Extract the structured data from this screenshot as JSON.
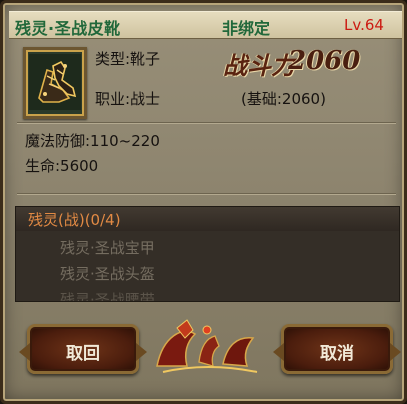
{
  "item": {
    "name": "残灵·圣战皮靴",
    "bind_status": "非绑定",
    "level": "Lv.64",
    "type": "类型:靴子",
    "class": "职业:战士",
    "power_label": "战斗力",
    "power_value": "2060",
    "base_power": "(基础:2060)",
    "magic_defense": "魔法防御:110~220",
    "hp": "生命:5600"
  },
  "set": {
    "title": "残灵(战)(0/4)",
    "items": [
      "残灵·圣战宝甲",
      "残灵·圣战头盔",
      "残灵·圣战腰带"
    ]
  },
  "buttons": {
    "back": "取回",
    "cancel": "取消"
  },
  "colors": {
    "title_green": "#21683a",
    "level_red": "#cc1a12",
    "set_title_orange": "#e28a44"
  }
}
